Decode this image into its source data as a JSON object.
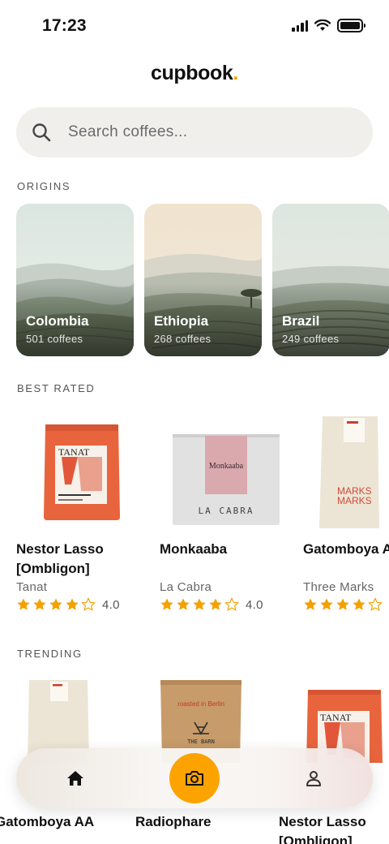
{
  "status": {
    "time": "17:23"
  },
  "app": {
    "name": "cupbook",
    "accent": "#f5a000"
  },
  "search": {
    "placeholder": "Search coffees..."
  },
  "sections": {
    "origins": "ORIGINS",
    "best_rated": "BEST RATED",
    "trending": "TRENDING"
  },
  "origins": [
    {
      "name": "Colombia",
      "count": "501 coffees"
    },
    {
      "name": "Ethiopia",
      "count": "268 coffees"
    },
    {
      "name": "Brazil",
      "count": "249 coffees"
    }
  ],
  "best_rated": [
    {
      "name": "Nestor Lasso [Ombligon]",
      "roaster": "Tanat",
      "rating": "4.0",
      "stars": 4,
      "bag_label": "TANAT"
    },
    {
      "name": "Monkaaba",
      "roaster": "La Cabra",
      "rating": "4.0",
      "stars": 4,
      "bag_label": "Monkaaba",
      "bag_brand": "LA CABRA"
    },
    {
      "name": "Gatomboya AA",
      "roaster": "Three Marks",
      "rating": "",
      "stars": 4,
      "bag_label": "MARKS"
    }
  ],
  "trending": [
    {
      "name": "Gatomboya AA"
    },
    {
      "name": "Radiophare",
      "bag_brand": "THE BARN",
      "bag_top": "roasted in Berlin"
    },
    {
      "name": "Nestor Lasso [Ombligon]",
      "bag_label": "TANAT"
    }
  ],
  "nav": {
    "home_icon": "home-icon",
    "camera_icon": "camera-icon",
    "profile_icon": "profile-icon",
    "active_color": "#fca300"
  }
}
